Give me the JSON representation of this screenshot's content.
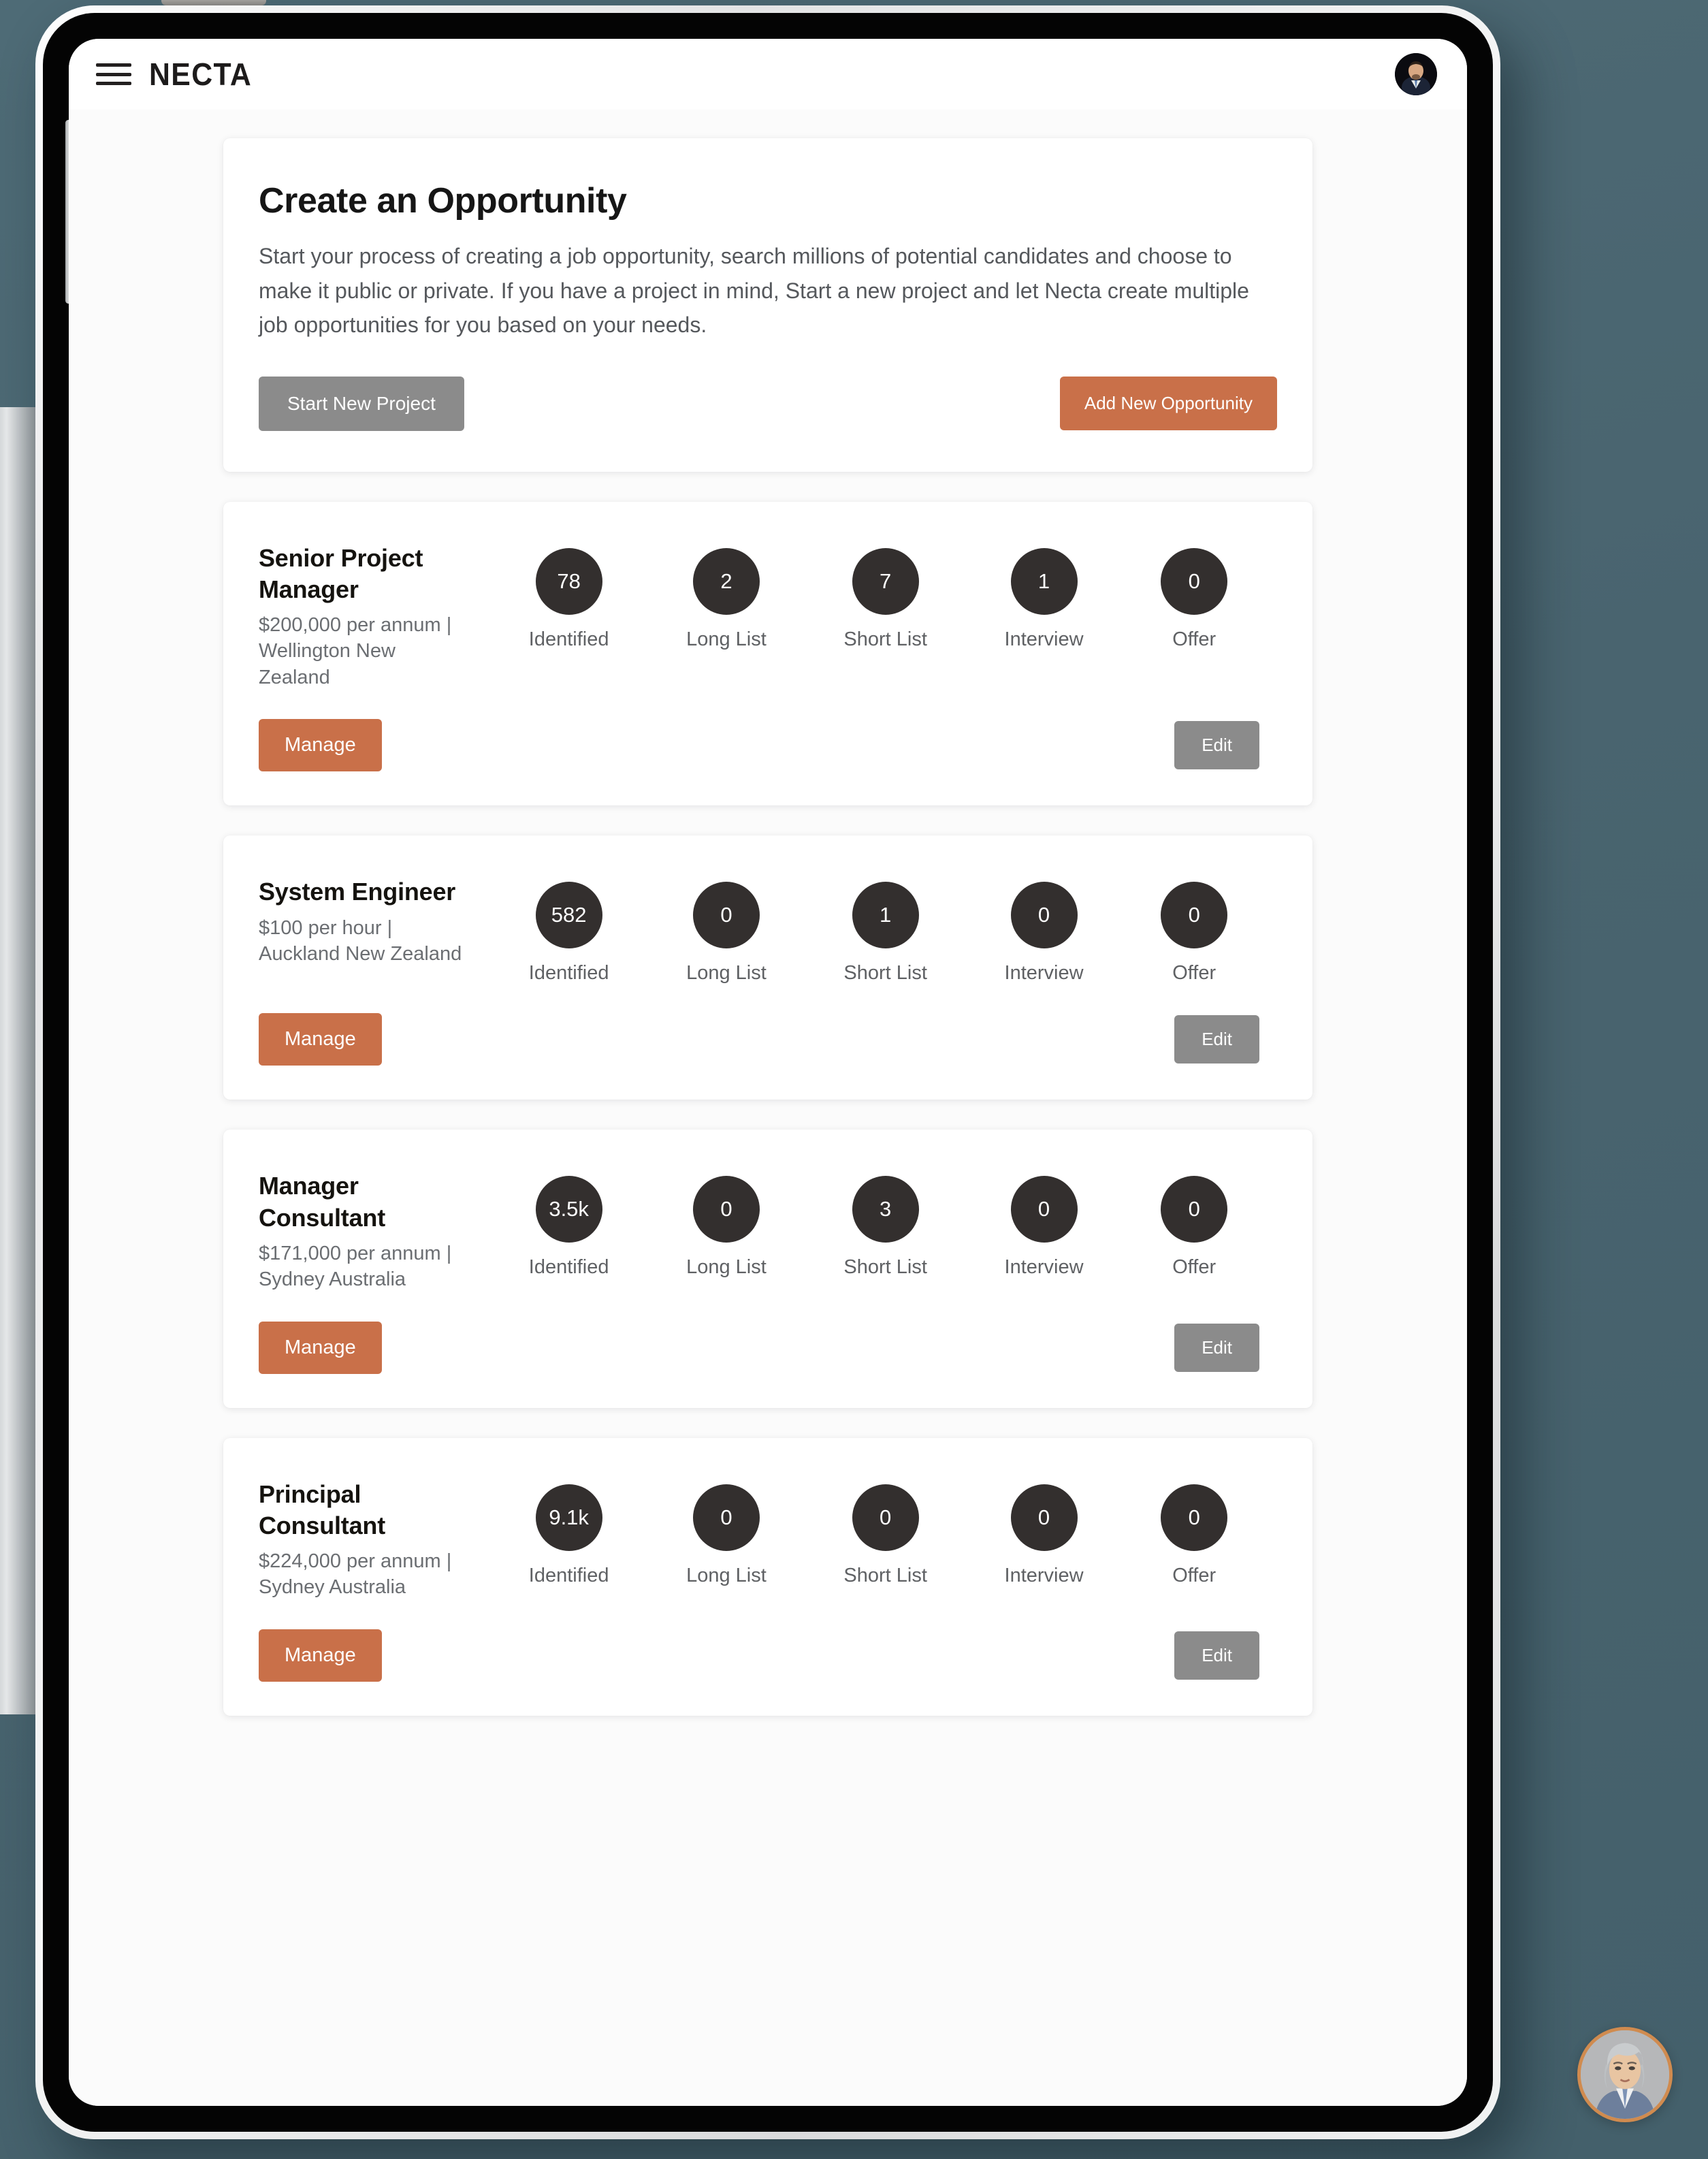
{
  "device": {
    "type": "tablet-mockup",
    "stylus": "apple-pencil"
  },
  "header": {
    "menu_icon": "hamburger-menu-icon",
    "brand": "NECTA",
    "avatar_icon": "user-avatar"
  },
  "intro": {
    "title": "Create an Opportunity",
    "description": "Start your process of creating a job opportunity, search millions of potential candidates and choose to make it public or private. If you have a project in mind, Start a new project and let Necta create multiple job opportunities for you based on your needs.",
    "start_project_label": "Start New Project",
    "add_opportunity_label": "Add New Opportunity"
  },
  "stat_labels": [
    "Identified",
    "Long List",
    "Short List",
    "Interview",
    "Offer"
  ],
  "actions": {
    "manage_label": "Manage",
    "edit_label": "Edit"
  },
  "opportunities": [
    {
      "title": "Senior Project Manager",
      "meta": "$200,000 per annum | Wellington New Zealand",
      "stats": [
        "78",
        "2",
        "7",
        "1",
        "0"
      ]
    },
    {
      "title": "System Engineer",
      "meta": "$100 per hour | Auckland New Zealand",
      "stats": [
        "582",
        "0",
        "1",
        "0",
        "0"
      ]
    },
    {
      "title": "Manager Consultant",
      "meta": "$171,000 per annum | Sydney Australia",
      "stats": [
        "3.5k",
        "0",
        "3",
        "0",
        "0"
      ]
    },
    {
      "title": "Principal Consultant",
      "meta": "$224,000 per annum | Sydney Australia",
      "stats": [
        "9.1k",
        "0",
        "0",
        "0",
        "0"
      ]
    }
  ],
  "assistant": {
    "icon": "assistant-avatar-icon"
  },
  "colors": {
    "accent_orange": "#c97049",
    "muted_gray": "#8b8b8b",
    "bubble_dark": "#332f2e",
    "backdrop": "#4b6570"
  }
}
